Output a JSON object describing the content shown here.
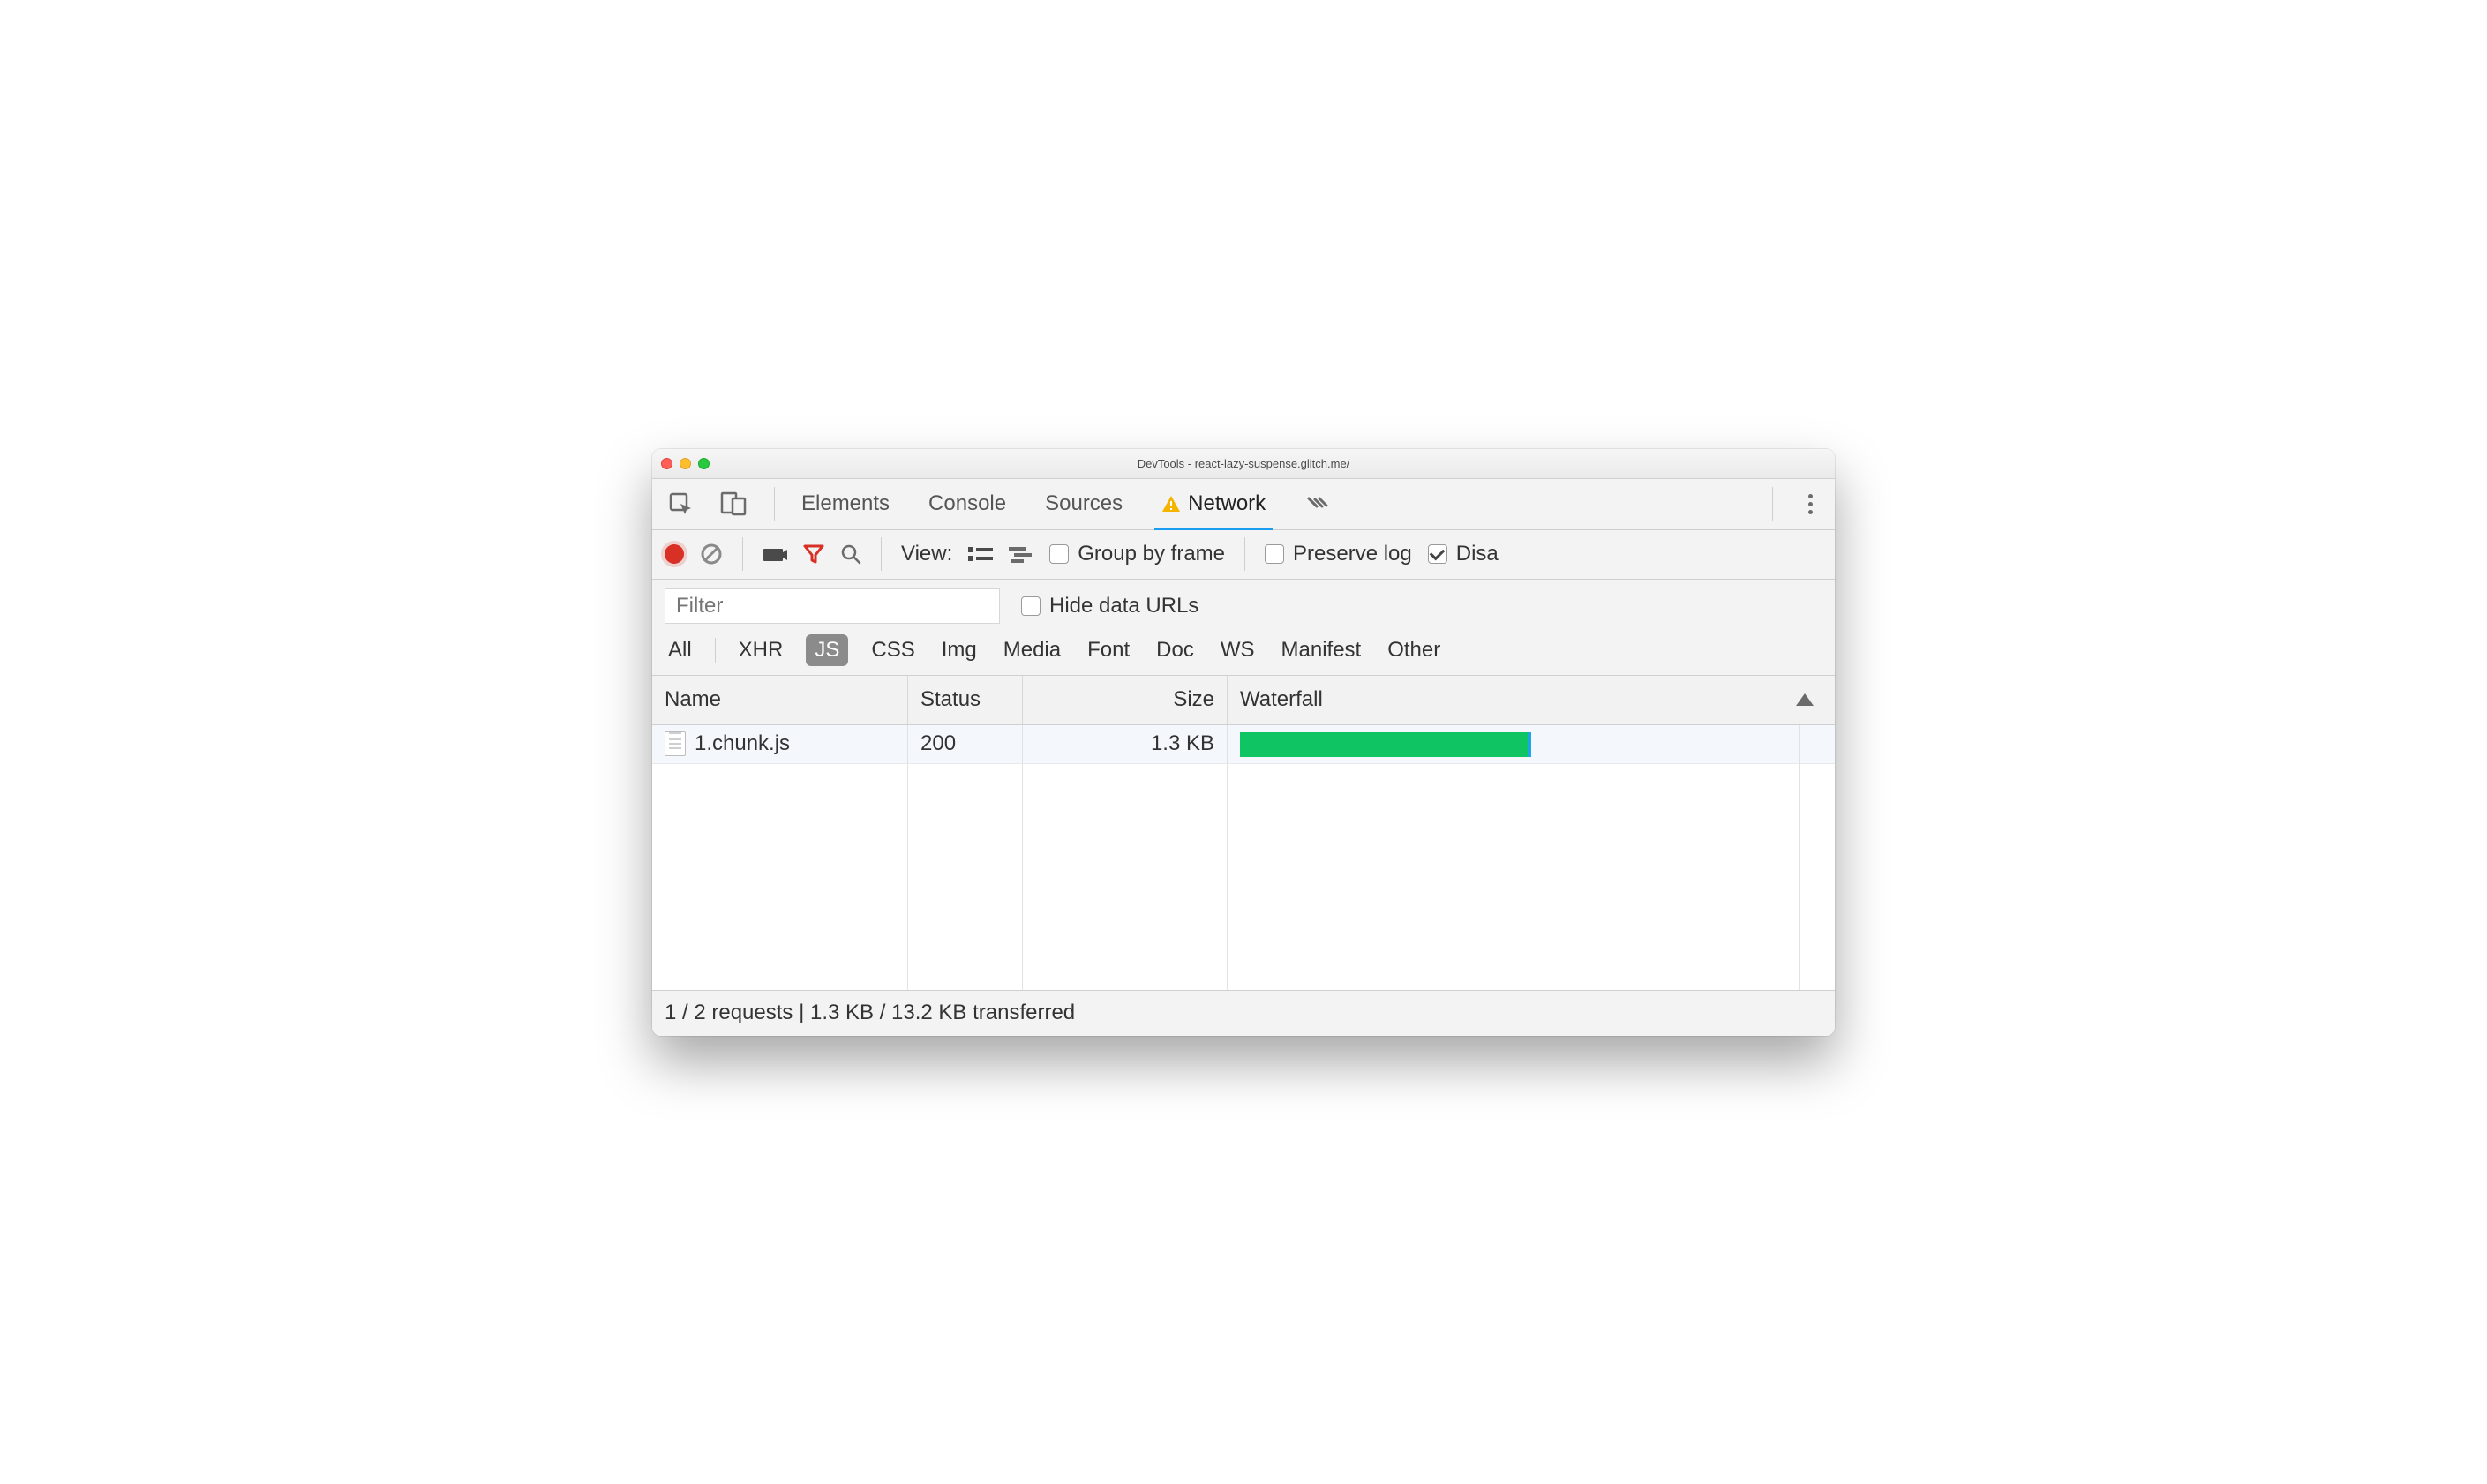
{
  "window": {
    "title": "DevTools - react-lazy-suspense.glitch.me/"
  },
  "tabs": {
    "elements": "Elements",
    "console": "Console",
    "sources": "Sources",
    "network": "Network"
  },
  "toolbar": {
    "view_label": "View:",
    "group_by_frame": "Group by frame",
    "preserve_log": "Preserve log",
    "disable_cache_partial": "Disa"
  },
  "filter": {
    "placeholder": "Filter",
    "hide_data_urls": "Hide data URLs"
  },
  "types": {
    "all": "All",
    "xhr": "XHR",
    "js": "JS",
    "css": "CSS",
    "img": "Img",
    "media": "Media",
    "font": "Font",
    "doc": "Doc",
    "ws": "WS",
    "manifest": "Manifest",
    "other": "Other"
  },
  "columns": {
    "name": "Name",
    "status": "Status",
    "size": "Size",
    "waterfall": "Waterfall"
  },
  "rows": [
    {
      "name": "1.chunk.js",
      "status": "200",
      "size": "1.3 KB",
      "wf_left_pct": 2,
      "wf_width_pct": 48
    }
  ],
  "status": "1 / 2 requests | 1.3 KB / 13.2 KB transferred"
}
